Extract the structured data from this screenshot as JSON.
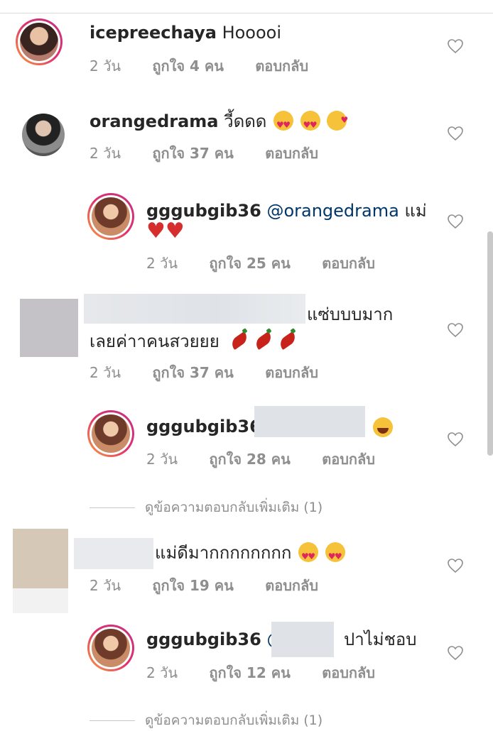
{
  "comments": [
    {
      "username": "icepreechaya",
      "text": "Hooooi",
      "age": "2 วัน",
      "likes": "ถูกใจ 4 คน",
      "reply": "ตอบกลับ"
    },
    {
      "username": "orangedrama",
      "text": "วี้ดดด",
      "age": "2 วัน",
      "likes": "ถูกใจ 37 คน",
      "reply": "ตอบกลับ"
    },
    {
      "username": "gggubgib36",
      "mention": "@orangedrama",
      "text": "แม่",
      "age": "2 วัน",
      "likes": "ถูกใจ 25 คน",
      "reply": "ตอบกลับ"
    },
    {
      "text_line1": "แซ่บบบมาก",
      "text_line2": "เลยค่าาคนสวยยย",
      "age": "2 วัน",
      "likes": "ถูกใจ 37 คน",
      "reply": "ตอบกลับ"
    },
    {
      "username": "gggubgib36",
      "age": "2 วัน",
      "likes": "ถูกใจ 28 คน",
      "reply": "ตอบกลับ"
    },
    {
      "text": "แม่ดีมากกกกกกกก",
      "age": "2 วัน",
      "likes": "ถูกใจ 19 คน",
      "reply": "ตอบกลับ"
    },
    {
      "username": "gggubgib36",
      "mention": "@",
      "text": "ปาไม่ชอบ",
      "age": "2 วัน",
      "likes": "ถูกใจ 12 คน",
      "reply": "ตอบกลับ"
    }
  ],
  "view_more_1": "ดูข้อความตอบกลับเพิ่มเติม (1)",
  "view_more_2": "ดูข้อความตอบกลับเพิ่มเติม (1)",
  "colors": {
    "mention": "#00376b",
    "meta": "#8e8e8e",
    "redaction": "#dfe3e8"
  }
}
